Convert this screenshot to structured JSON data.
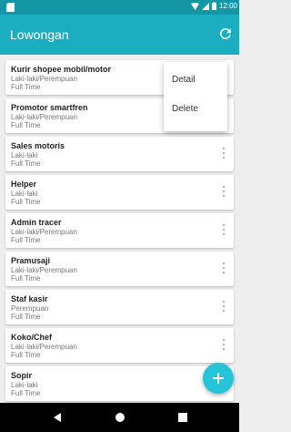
{
  "status_bar": {
    "time": "12:00"
  },
  "app_bar": {
    "title": "Lowongan",
    "refresh_icon": "refresh-icon"
  },
  "jobs": [
    {
      "title": "Kurir shopee mobil/motor",
      "gender": "Laki-laki/Perempuan",
      "type": "Full Time"
    },
    {
      "title": "Promotor smartfren",
      "gender": "Laki-laki/Perempuan",
      "type": "Full Time"
    },
    {
      "title": "Sales motoris",
      "gender": "Laki-laki",
      "type": "Full Time"
    },
    {
      "title": "Helper",
      "gender": "Laki-laki",
      "type": "Full Time"
    },
    {
      "title": "Admin tracer",
      "gender": "Laki-laki/Perempuan",
      "type": "Full Time"
    },
    {
      "title": "Pramusaji",
      "gender": "Laki-laki/Perempuan",
      "type": "Full Time"
    },
    {
      "title": "Staf kasir",
      "gender": "Perempuan",
      "type": "Full Time"
    },
    {
      "title": "Koko/Chef",
      "gender": "Laki-laki/Perempuan",
      "type": "Full Time"
    },
    {
      "title": "Sopir",
      "gender": "Laki-laki",
      "type": "Full Time"
    }
  ],
  "context_menu": {
    "items": [
      "Detail",
      "Delete"
    ]
  },
  "fab": {
    "icon": "plus-icon"
  },
  "colors": {
    "primary": "#1aaec0",
    "primary_dark": "#1596a6",
    "accent": "#25c4d8"
  }
}
